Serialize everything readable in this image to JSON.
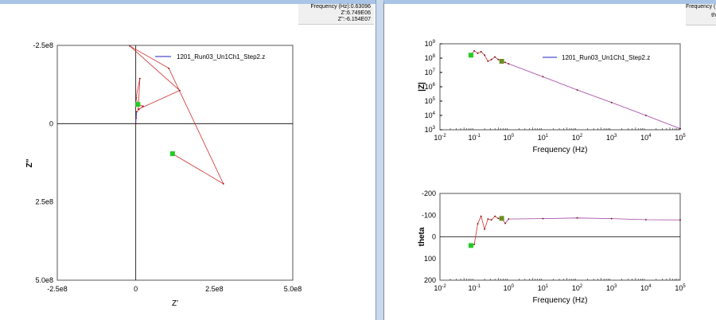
{
  "info_left": {
    "freq_label": "Frequency (Hz):0.63096",
    "zreal": "Z':6.749E06",
    "zimag": "Z'':-6.154E07"
  },
  "info_right": {
    "freq_label": "Frequency (",
    "theta_label": "th"
  },
  "colors": {
    "trace": "#d03030",
    "line_blue": "#2020c0",
    "marker_green": "#22cc22",
    "marker_olive": "#6b8e23",
    "axis": "#000"
  },
  "chart_data": [
    {
      "type": "line",
      "name": "nyquist",
      "xlabel": "Z'",
      "ylabel": "Z''",
      "xlim": [
        -250000000.0,
        500000000.0
      ],
      "ylim": [
        -250000000.0,
        500000000.0
      ],
      "y_inverted": true,
      "xticks": [
        "-2.5e8",
        "0",
        "2.5e8",
        "5.0e8"
      ],
      "yticks": [
        "-2.5e8",
        "0",
        "2.5e8",
        "5.0e8"
      ],
      "legend": "1201_Run03_Un1Ch1_Step2.z",
      "legend_position": "top-right",
      "x": [
        117000000.0,
        279000000.0,
        105000000.0,
        -19000000.0,
        140000000.0,
        8000000.0,
        13000000.0,
        1000000.0,
        6749000.0,
        23000000.0,
        3000000.0,
        1000000.0,
        0
      ],
      "y": [
        96000000.0,
        192000000.0,
        -177000000.0,
        -248000000.0,
        -106000000.0,
        -46000000.0,
        -144000000.0,
        -83000000.0,
        -61540000.0,
        -56000000.0,
        -38000000.0,
        -18000000.0,
        0
      ]
    },
    {
      "type": "line",
      "name": "bode-magnitude",
      "xlabel": "Frequency (Hz)",
      "ylabel": "|Z|",
      "xscale": "log",
      "yscale": "log",
      "xlim": [
        0.01,
        100000.0
      ],
      "ylim": [
        1000.0,
        1000000000.0
      ],
      "xticks": [
        "-2",
        "-1",
        "0",
        "1",
        "2",
        "3",
        "4",
        "5"
      ],
      "yticks": [
        "3",
        "4",
        "5",
        "6",
        "7",
        "8",
        "9"
      ],
      "legend": "1201_Run03_Un1Ch1_Step2.z",
      "legend_position": "top-right",
      "x": [
        0.08,
        0.1,
        0.126,
        0.158,
        0.2,
        0.25,
        0.316,
        0.4,
        0.5,
        0.63,
        0.8,
        1,
        10,
        100,
        1000,
        10000,
        100000
      ],
      "y": [
        160000000.0,
        320000000.0,
        220000000.0,
        280000000.0,
        160000000.0,
        60000000.0,
        80000000.0,
        120000000.0,
        80000000.0,
        60000000.0,
        50000000.0,
        40000000.0,
        5000000.0,
        600000.0,
        80000.0,
        10000.0,
        1200.0
      ]
    },
    {
      "type": "line",
      "name": "bode-phase",
      "xlabel": "Frequency (Hz)",
      "ylabel": "theta",
      "xscale": "log",
      "xlim": [
        0.01,
        100000.0
      ],
      "ylim": [
        -200,
        200
      ],
      "y_inverted": true,
      "xticks": [
        "-2",
        "-1",
        "0",
        "1",
        "2",
        "3",
        "4",
        "5"
      ],
      "yticks": [
        "-200",
        "-100",
        "0",
        "100",
        "200"
      ],
      "x": [
        0.08,
        0.1,
        0.126,
        0.158,
        0.2,
        0.25,
        0.316,
        0.4,
        0.5,
        0.63,
        0.8,
        1,
        10,
        100,
        1000,
        10000,
        100000
      ],
      "y": [
        40,
        35,
        -60,
        -95,
        -35,
        -82,
        -78,
        -95,
        -85,
        -85,
        -62,
        -82,
        -84,
        -87,
        -84,
        -79,
        -78
      ]
    }
  ]
}
